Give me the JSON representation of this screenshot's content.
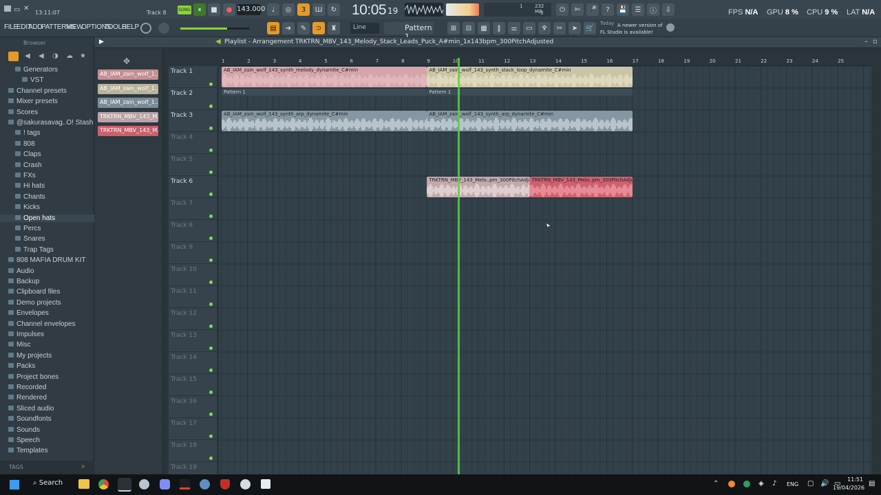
{
  "titlebar": {
    "time_stamp": "13:11:07",
    "track_indicator": "Track 8",
    "song_label": "SONG",
    "tempo": "143.000",
    "clock": "10:05",
    "clock_sub": "19",
    "mem": "232 MB",
    "mem_sub1": "1",
    "mem_sub2": "3",
    "fps_label": "FPS",
    "fps_value": "N/A",
    "gpu_label": "GPU",
    "gpu_value": "8 %",
    "cpu_label": "CPU",
    "cpu_value": "9 %",
    "lat_label": "LAT",
    "lat_value": "N/A"
  },
  "menu": [
    "FILE",
    "EDIT",
    "ADD",
    "PATTERNS",
    "VIEW",
    "OPTIONS",
    "TOOLS",
    "HELP"
  ],
  "toolbar": {
    "snap": "Line",
    "pattern": "Pattern 1",
    "news_today": "Today",
    "news_text": "A newer version of FL Studio is available!"
  },
  "browser": {
    "title": "Browser",
    "items": [
      {
        "label": "Generators",
        "indent": 1
      },
      {
        "label": "VST",
        "indent": 2
      },
      {
        "label": "Channel presets",
        "indent": 0
      },
      {
        "label": "Mixer presets",
        "indent": 0
      },
      {
        "label": "Scores",
        "indent": 0
      },
      {
        "label": "@sakurasavag..O! Stash Kit",
        "indent": 0
      },
      {
        "label": "! tags",
        "indent": 1
      },
      {
        "label": "808",
        "indent": 1
      },
      {
        "label": "Claps",
        "indent": 1
      },
      {
        "label": "Crash",
        "indent": 1
      },
      {
        "label": "FXs",
        "indent": 1
      },
      {
        "label": "Hi hats",
        "indent": 1
      },
      {
        "label": "Chants",
        "indent": 1
      },
      {
        "label": "Kicks",
        "indent": 1
      },
      {
        "label": "Open hats",
        "indent": 1,
        "active": true
      },
      {
        "label": "Percs",
        "indent": 1
      },
      {
        "label": "Snares",
        "indent": 1
      },
      {
        "label": "Trap Tags",
        "indent": 1
      },
      {
        "label": "808 MAFIA DRUM KIT",
        "indent": 0
      },
      {
        "label": "Audio",
        "indent": 0
      },
      {
        "label": "Backup",
        "indent": 0
      },
      {
        "label": "Clipboard files",
        "indent": 0
      },
      {
        "label": "Demo projects",
        "indent": 0
      },
      {
        "label": "Envelopes",
        "indent": 0
      },
      {
        "label": "Channel envelopes",
        "indent": 0
      },
      {
        "label": "Impulses",
        "indent": 0
      },
      {
        "label": "Misc",
        "indent": 0
      },
      {
        "label": "My projects",
        "indent": 0
      },
      {
        "label": "Packs",
        "indent": 0
      },
      {
        "label": "Project bones",
        "indent": 0
      },
      {
        "label": "Recorded",
        "indent": 0
      },
      {
        "label": "Rendered",
        "indent": 0
      },
      {
        "label": "Sliced audio",
        "indent": 0
      },
      {
        "label": "Soundfonts",
        "indent": 0
      },
      {
        "label": "Sounds",
        "indent": 0
      },
      {
        "label": "Speech",
        "indent": 0
      },
      {
        "label": "Templates",
        "indent": 0
      }
    ],
    "tags_label": "TAGS"
  },
  "picker": {
    "clips": [
      {
        "label": "AB_IAM_zain_wolf_1...",
        "color": "#c48f93"
      },
      {
        "label": "AB_IAM_zain_wolf_1...",
        "color": "#b8b39a"
      },
      {
        "label": "AB_IAM_zain_wolf_1...",
        "color": "#7c8c97"
      },
      {
        "label": "TRKTRN_MBV_143_M...",
        "color": "#b9a3a6"
      },
      {
        "label": "TRKTRN_MBV_143_M...",
        "color": "#c9606c"
      }
    ]
  },
  "playlist": {
    "breadcrumb": "Playlist - Arrangement",
    "current": "TRKTRN_MBV_143_Melody_Stack_Leads_Puck_A#min_1x143bpm_300PitchAdjusted",
    "ruler": [
      "1",
      "2",
      "3",
      "4",
      "5",
      "6",
      "7",
      "8",
      "9",
      "10",
      "11",
      "12",
      "13",
      "14",
      "15",
      "16",
      "17",
      "18",
      "19",
      "20",
      "21",
      "22",
      "23",
      "24",
      "25"
    ],
    "tracks": [
      {
        "label": "Track 1",
        "active": true
      },
      {
        "label": "Track 2",
        "active": true
      },
      {
        "label": "Track 3",
        "active": true
      },
      {
        "label": "Track 4",
        "active": false
      },
      {
        "label": "Track 5",
        "active": false
      },
      {
        "label": "Track 6",
        "active": true
      },
      {
        "label": "Track 7",
        "active": false
      },
      {
        "label": "Track 8",
        "active": false
      },
      {
        "label": "Track 9",
        "active": false
      },
      {
        "label": "Track 10",
        "active": false
      },
      {
        "label": "Track 11",
        "active": false
      },
      {
        "label": "Track 12",
        "active": false
      },
      {
        "label": "Track 13",
        "active": false
      },
      {
        "label": "Track 14",
        "active": false
      },
      {
        "label": "Track 15",
        "active": false
      },
      {
        "label": "Track 16",
        "active": false
      },
      {
        "label": "Track 17",
        "active": false
      },
      {
        "label": "Track 18",
        "active": false
      },
      {
        "label": "Track 19",
        "active": false
      }
    ],
    "clips": [
      {
        "track": 1,
        "start": 1,
        "end": 9,
        "title": "AB_IAM_zain_wolf_143_synth_melody_dynamite_C#min",
        "color": "#d5a5aa",
        "wave": "#e7c4c8"
      },
      {
        "track": 1,
        "start": 9,
        "end": 17,
        "title": "AB_IAM_zain_wolf_143_synth_stack_loop_dynamite_C#min",
        "color": "#cbc5a8",
        "wave": "#ece6c9"
      },
      {
        "track": 2,
        "start": 1,
        "end": 9,
        "title": "Pattern 1",
        "color": "#3e4c56",
        "wave": ""
      },
      {
        "track": 2,
        "start": 9,
        "end": 17,
        "title": "Pattern 1",
        "color": "#3e4c56",
        "wave": ""
      },
      {
        "track": 3,
        "start": 1,
        "end": 9,
        "title": "AB_IAM_zain_wolf_143_synth_arp_dynamite_C#min",
        "color": "#8497a3",
        "wave": "#dbe3e8"
      },
      {
        "track": 3,
        "start": 9,
        "end": 17,
        "title": "AB_IAM_zain_wolf_143_synth_arp_dynamite_C#min",
        "color": "#8497a3",
        "wave": "#dbe3e8"
      },
      {
        "track": 6,
        "start": 9,
        "end": 13,
        "title": "TRKTRN_MBV_143_Melo..pm_300PitchAdjusted",
        "color": "#c2a9ac",
        "wave": "#f2e6e7"
      },
      {
        "track": 6,
        "start": 13,
        "end": 17,
        "title": "TRKTRN_MBV_143_Melo..pm_300PitchAdjusted",
        "color": "#d0606e",
        "wave": "#f3a7b0"
      }
    ],
    "playhead_bar": 10.2
  },
  "taskbar": {
    "search": "Search",
    "lang": "ENG",
    "time": "11:51",
    "date": "19/04/2026"
  }
}
